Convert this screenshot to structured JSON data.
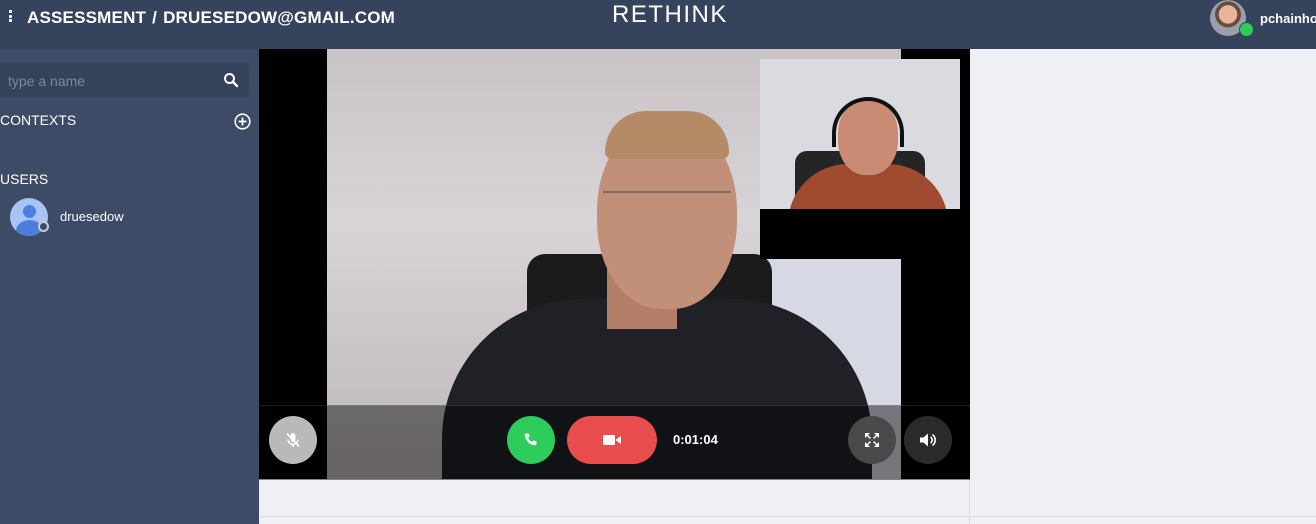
{
  "header": {
    "breadcrumb_section": "ASSESSMENT",
    "breadcrumb_separator": "/",
    "breadcrumb_context": "DRUESEDOW@GMAIL.COM",
    "logo_text": "RETHINK",
    "current_user": "pchainho",
    "current_user_status_color": "#2ecc5b"
  },
  "sidebar": {
    "search_placeholder": "type a name",
    "contexts_label": "CONTEXTS",
    "users_label": "USERS",
    "users": [
      {
        "name": "druesedow",
        "status": "offline"
      }
    ]
  },
  "call": {
    "timer": "0:01:04",
    "icons": [
      "mic-off-icon",
      "phone-icon",
      "video-camera-icon",
      "fullscreen-icon",
      "volume-icon"
    ],
    "colors": {
      "accept": "#2ecc5b",
      "video": "#e84c4c",
      "mute": "#b9b9b9"
    }
  }
}
